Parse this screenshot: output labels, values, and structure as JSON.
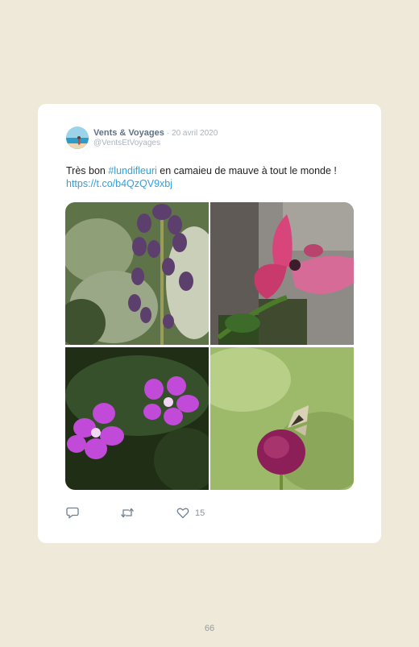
{
  "tweet": {
    "author_name": "Vents & Voyages",
    "date": "20 avril 2020",
    "handle": "@VentsEtVoyages",
    "text_part1": "Très bon ",
    "hashtag": "#lundifleuri",
    "text_part2": " en camaieu de mauve à tout le monde ! ",
    "link": "https://t.co/b4QzQV9xbj",
    "likes": "15"
  },
  "icons": [
    "reply-icon",
    "retweet-icon",
    "heart-icon"
  ],
  "colors": {
    "background": "#efe9da",
    "card": "#ffffff",
    "link": "#2fa0e0",
    "name": "#5f7186"
  },
  "page_number": "66"
}
